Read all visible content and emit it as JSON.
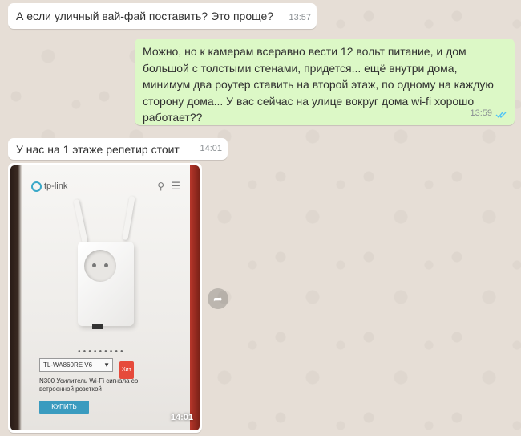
{
  "messages": [
    {
      "id": "m1",
      "direction": "incoming",
      "text": "А если уличный вай-фай поставить? Это проще?",
      "time": "13:57"
    },
    {
      "id": "m2",
      "direction": "outgoing",
      "text": "Можно, но к камерам всеравно вести 12 вольт питание, и дом большой с толстыми стенами, придется... ещё внутри дома, минимум два роутер ставить на второй этаж, по одному на каждую сторону дома... У вас сейчас на улице вокруг дома wi-fi хорошо работает??",
      "time": "13:59",
      "status": "read"
    },
    {
      "id": "m3",
      "direction": "incoming",
      "text": "У нас на 1 этаже репетир стоит",
      "time": "14:01"
    },
    {
      "id": "m4",
      "direction": "incoming",
      "type": "image",
      "time": "14:01"
    }
  ],
  "photo": {
    "brand": "tp-link",
    "model_select": "TL-WA860RE V6",
    "badge": "Хит",
    "description": "N300 Усилитель Wi-Fi сигнала со встроенной розеткой",
    "buy_label": "КУПИТЬ"
  },
  "icons": {
    "read_receipt": "double-check-icon",
    "forward": "forward-icon"
  },
  "colors": {
    "incoming_bubble": "#ffffff",
    "outgoing_bubble": "#dcf8c6",
    "read_check": "#4fc3f7",
    "buy_button": "#3a9bbf",
    "badge": "#e64a3b"
  }
}
